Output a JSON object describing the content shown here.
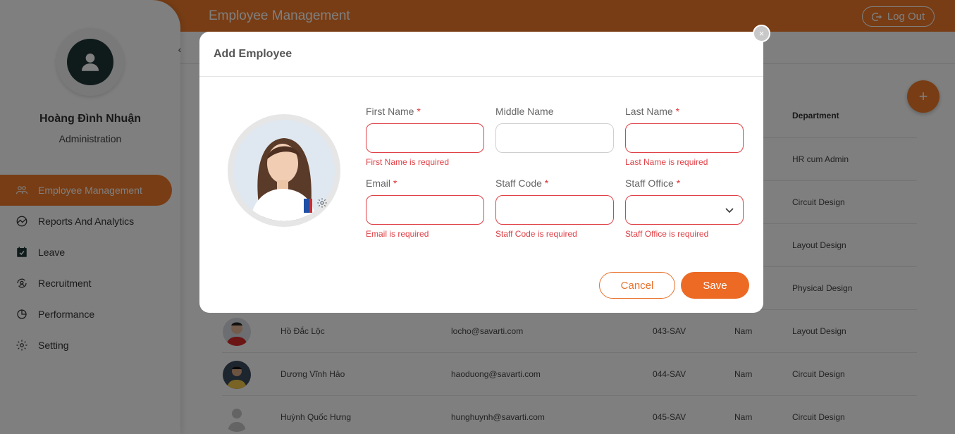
{
  "header": {
    "title": "Employee Management",
    "logout_label": "Log Out"
  },
  "sidebar": {
    "user_name": "Hoàng Đình Nhuận",
    "user_role": "Administration",
    "items": [
      {
        "label": "Employee Management",
        "icon": "users-icon",
        "active": true
      },
      {
        "label": "Reports And Analytics",
        "icon": "chart-icon",
        "active": false
      },
      {
        "label": "Leave",
        "icon": "calendar-icon",
        "active": false
      },
      {
        "label": "Recruitment",
        "icon": "recruitment-icon",
        "active": false
      },
      {
        "label": "Performance",
        "icon": "performance-icon",
        "active": false
      },
      {
        "label": "Setting",
        "icon": "gear-icon",
        "active": false
      }
    ]
  },
  "table": {
    "dept_header": "Department",
    "background_depts": [
      "HR cum Admin",
      "Circuit Design",
      "Layout Design",
      "Physical Design"
    ],
    "rows": [
      {
        "name": "Hồ Đắc Lộc",
        "email": "locho@savarti.com",
        "code": "043-SAV",
        "gender": "Nam",
        "dept": "Layout Design"
      },
      {
        "name": "Dương Vĩnh Hảo",
        "email": "haoduong@savarti.com",
        "code": "044-SAV",
        "gender": "Nam",
        "dept": "Circuit Design"
      },
      {
        "name": "Huỳnh Quốc Hưng",
        "email": "hunghuynh@savarti.com",
        "code": "045-SAV",
        "gender": "Nam",
        "dept": "Circuit Design"
      }
    ]
  },
  "modal": {
    "title": "Add Employee",
    "close_symbol": "×",
    "fields": {
      "first_name": {
        "label": "First Name",
        "required": "*",
        "value": "",
        "error": "First Name is required"
      },
      "middle_name": {
        "label": "Middle Name",
        "value": ""
      },
      "last_name": {
        "label": "Last Name",
        "required": "*",
        "value": "",
        "error": "Last Name is required"
      },
      "email": {
        "label": "Email",
        "required": "*",
        "value": "",
        "error": "Email is required"
      },
      "staff_code": {
        "label": "Staff Code",
        "required": "*",
        "value": "",
        "error": "Staff Code is required"
      },
      "staff_office": {
        "label": "Staff Office",
        "required": "*",
        "value": "",
        "error": "Staff Office is required"
      }
    },
    "cancel_label": "Cancel",
    "save_label": "Save"
  },
  "colors": {
    "accent": "#f07b2a",
    "error": "#e04046",
    "save": "#ec6a24"
  },
  "fab_symbol": "+"
}
